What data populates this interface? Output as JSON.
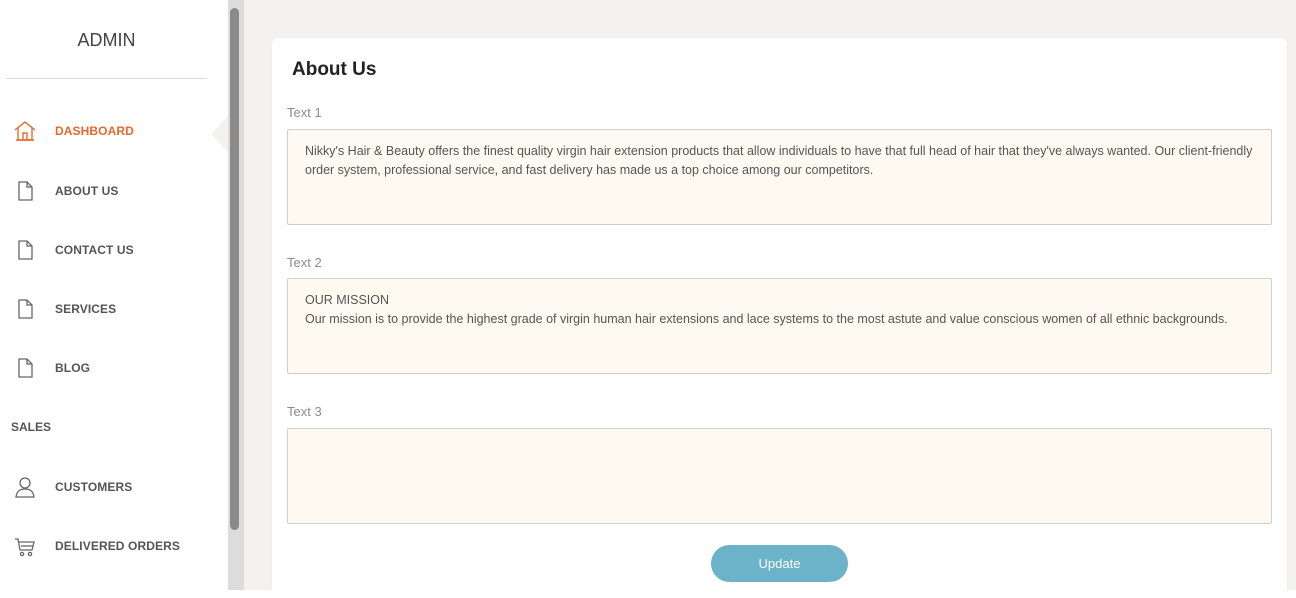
{
  "sidebar": {
    "brand": "ADMIN",
    "items": [
      {
        "label": "DASHBOARD",
        "icon": "home-icon",
        "active": true
      },
      {
        "label": "ABOUT US",
        "icon": "page-icon"
      },
      {
        "label": "CONTACT US",
        "icon": "page-icon"
      },
      {
        "label": "SERVICES",
        "icon": "page-icon"
      },
      {
        "label": "BLOG",
        "icon": "page-icon"
      }
    ],
    "section_sales": "SALES",
    "sales_items": [
      {
        "label": "CUSTOMERS",
        "icon": "user-icon"
      },
      {
        "label": "DELIVERED ORDERS",
        "icon": "cart-icon"
      }
    ],
    "accent_color": "#e8682d"
  },
  "main": {
    "title": "About Us",
    "fields": [
      {
        "label": "Text 1",
        "value": "Nikky's Hair & Beauty offers the finest quality virgin hair extension products that allow individuals to have that full head of hair that they've always wanted. Our client-friendly order system, professional service, and fast delivery has made us a top choice among our competitors."
      },
      {
        "label": "Text 2",
        "value": "OUR MISSION\nOur mission is to provide the highest grade of virgin human hair extensions and lace systems to the most astute and value conscious women of all ethnic backgrounds."
      },
      {
        "label": "Text 3",
        "value": ""
      }
    ],
    "update_label": "Update",
    "button_color": "#6cb2c8"
  }
}
